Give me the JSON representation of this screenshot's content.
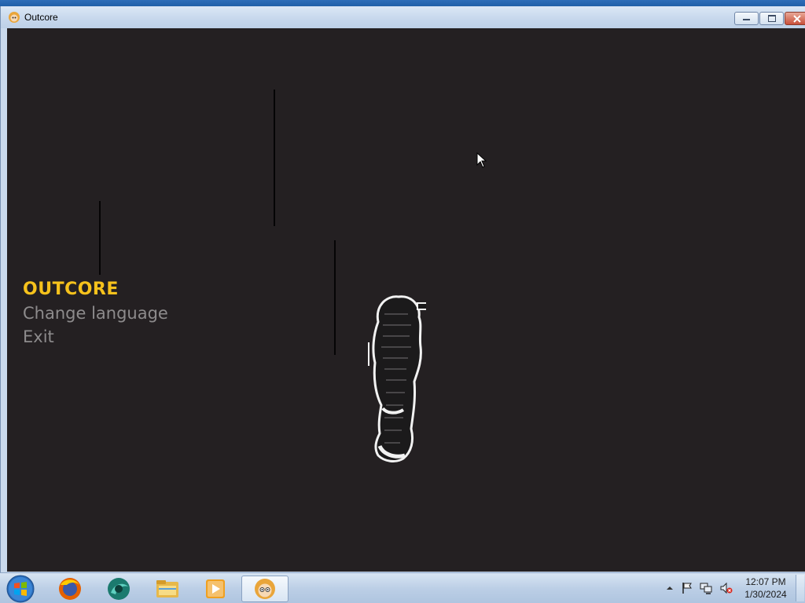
{
  "window": {
    "title": "Outcore",
    "app_icon": "outcore-app-icon",
    "minimize_icon": "minimize-icon",
    "maximize_icon": "maximize-icon",
    "close_icon": "close-icon"
  },
  "game": {
    "menu": {
      "title": "OUTCORE",
      "items": [
        "Change language",
        "Exit"
      ]
    },
    "colors": {
      "background": "#242022",
      "title": "#f6c21c",
      "item": "#8d8b8c"
    }
  },
  "taskbar": {
    "start_icon": "windows-start-icon",
    "apps": [
      {
        "name": "firefox-icon"
      },
      {
        "name": "app-circle-icon"
      },
      {
        "name": "file-explorer-icon"
      },
      {
        "name": "media-player-icon"
      },
      {
        "name": "outcore-taskbar-icon",
        "active": true
      }
    ],
    "tray": [
      "show-hidden-icons-icon",
      "action-center-flag-icon",
      "network-icon",
      "volume-muted-icon"
    ],
    "clock": {
      "time": "12:07 PM",
      "date": "1/30/2024"
    }
  }
}
